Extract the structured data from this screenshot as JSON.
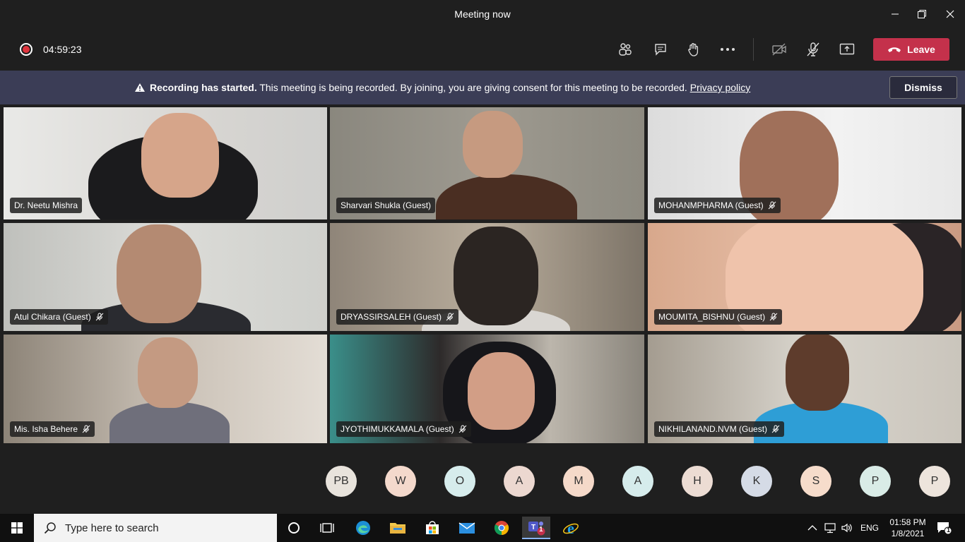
{
  "window": {
    "title": "Meeting now"
  },
  "toolbar": {
    "timer": "04:59:23",
    "leave_label": "Leave"
  },
  "banner": {
    "bold": "Recording has started.",
    "text": " This meeting is being recorded. By joining, you are giving consent for this meeting to be recorded. ",
    "link": "Privacy policy",
    "dismiss_label": "Dismiss"
  },
  "participants": [
    {
      "name": "Dr. Neetu Mishra",
      "muted": false
    },
    {
      "name": "Sharvari Shukla (Guest)",
      "muted": false
    },
    {
      "name": "MOHANMPHARMA (Guest)",
      "muted": true
    },
    {
      "name": "Atul Chikara (Guest)",
      "muted": true
    },
    {
      "name": "DRYASSIRSALEH (Guest)",
      "muted": true
    },
    {
      "name": "MOUMITA_BISHNU (Guest)",
      "muted": true
    },
    {
      "name": "Mis. Isha Behere",
      "muted": true
    },
    {
      "name": "JYOTHIMUKKAMALA (Guest)",
      "muted": true
    },
    {
      "name": "NIKHILANAND.NVM (Guest)",
      "muted": true
    }
  ],
  "avatars": [
    {
      "initials": "PB",
      "color": "#e8e3dc"
    },
    {
      "initials": "W",
      "color": "#f4d9cc"
    },
    {
      "initials": "O",
      "color": "#d6ecec"
    },
    {
      "initials": "A",
      "color": "#ecd8d0"
    },
    {
      "initials": "M",
      "color": "#f5d9c9"
    },
    {
      "initials": "A",
      "color": "#d6ecec"
    },
    {
      "initials": "H",
      "color": "#ecdcd3"
    },
    {
      "initials": "K",
      "color": "#d5dbe6"
    },
    {
      "initials": "S",
      "color": "#f6dccb"
    },
    {
      "initials": "P",
      "color": "#d9ece7"
    },
    {
      "initials": "P",
      "color": "#ede4dc"
    }
  ],
  "taskbar": {
    "search_placeholder": "Type here to search",
    "language": "ENG",
    "time": "01:58 PM",
    "date": "1/8/2021",
    "teams_badge": "1",
    "notification_badge": "1"
  },
  "colors": {
    "leave": "#c4314b",
    "banner": "#3b3d56",
    "recording": "#e0353e"
  }
}
